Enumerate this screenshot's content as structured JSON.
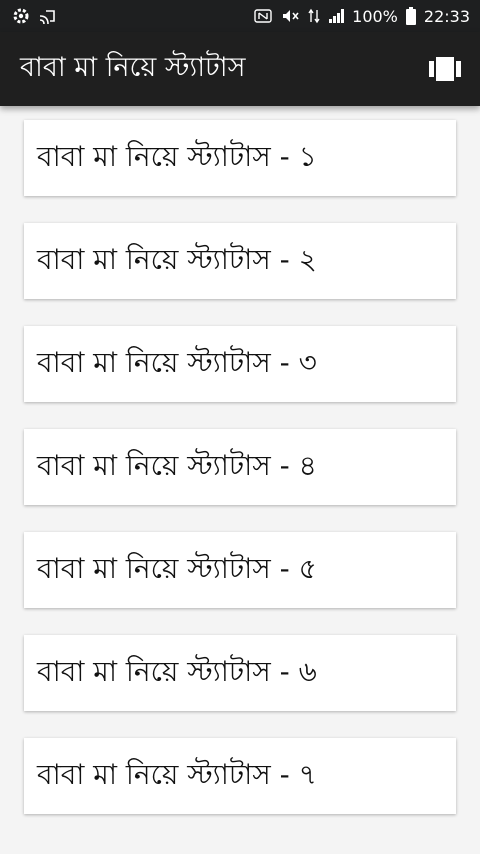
{
  "status_bar": {
    "battery": "100%",
    "time": "22:33",
    "icons_left": [
      "settings-icon",
      "cast-icon"
    ],
    "icons_right": [
      "nfc-icon",
      "mute-icon",
      "data-arrows-icon",
      "signal-icon",
      "battery-icon"
    ]
  },
  "app_bar": {
    "title": "বাবা মা নিয়ে স্ট্যাটাস",
    "action_icon": "view-carousel-icon",
    "background": "#1f1f1f"
  },
  "items": [
    {
      "label": "বাবা মা নিয়ে স্ট্যাটাস - ১"
    },
    {
      "label": "বাবা মা নিয়ে স্ট্যাটাস - ২"
    },
    {
      "label": "বাবা মা নিয়ে স্ট্যাটাস - ৩"
    },
    {
      "label": "বাবা মা নিয়ে স্ট্যাটাস - ৪"
    },
    {
      "label": "বাবা মা নিয়ে স্ট্যাটাস - ৫"
    },
    {
      "label": "বাবা মা নিয়ে স্ট্যাটাস - ৬"
    },
    {
      "label": "বাবা মা নিয়ে স্ট্যাটাস - ৭"
    }
  ]
}
